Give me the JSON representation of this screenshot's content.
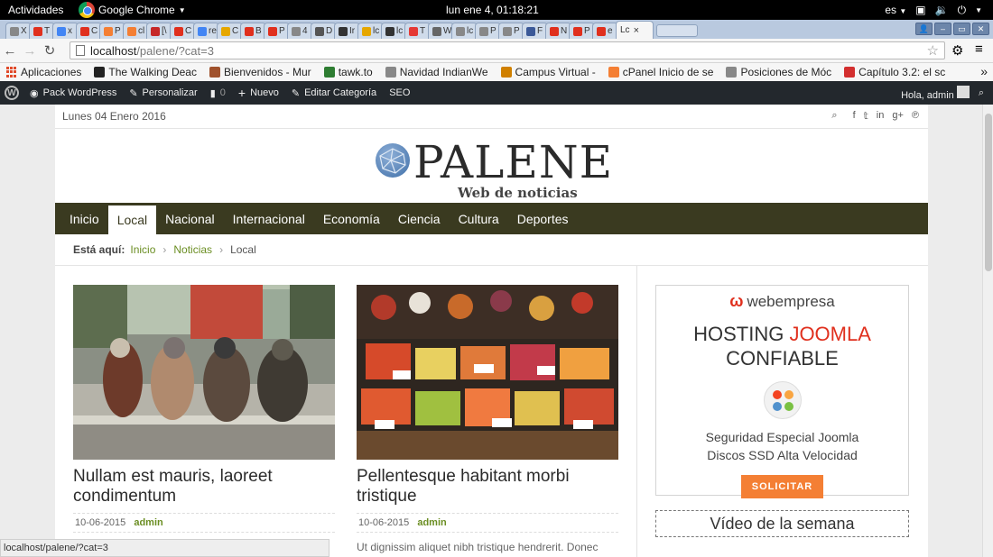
{
  "gnome": {
    "activities": "Actividades",
    "app_name": "Google Chrome",
    "clock": "lun ene  4, 01:18:21",
    "lang": "es"
  },
  "tabs": [
    {
      "letter": "X",
      "color": "#888"
    },
    {
      "letter": "T",
      "color": "#e0301e"
    },
    {
      "letter": "x",
      "color": "#4285f4"
    },
    {
      "letter": "C",
      "color": "#e0301e"
    },
    {
      "letter": "P",
      "color": "#f47f34"
    },
    {
      "letter": "cl",
      "color": "#f47f34"
    },
    {
      "letter": "[\\",
      "color": "#c62828"
    },
    {
      "letter": "C",
      "color": "#e0301e"
    },
    {
      "letter": "re",
      "color": "#4285f4"
    },
    {
      "letter": "C",
      "color": "#e6a700"
    },
    {
      "letter": "B",
      "color": "#e0301e"
    },
    {
      "letter": "P",
      "color": "#e0301e"
    },
    {
      "letter": "4",
      "color": "#888"
    },
    {
      "letter": "D",
      "color": "#555"
    },
    {
      "letter": "Ir",
      "color": "#333"
    },
    {
      "letter": "lc",
      "color": "#e6a700"
    },
    {
      "letter": "lc",
      "color": "#333"
    },
    {
      "letter": "T",
      "color": "#e53935"
    },
    {
      "letter": "W",
      "color": "#666"
    },
    {
      "letter": "lc",
      "color": "#888"
    },
    {
      "letter": "P",
      "color": "#888"
    },
    {
      "letter": "P",
      "color": "#888"
    },
    {
      "letter": "F",
      "color": "#3b5998"
    },
    {
      "letter": "N",
      "color": "#e0301e"
    },
    {
      "letter": "P",
      "color": "#e0301e"
    },
    {
      "letter": "e",
      "color": "#e0301e"
    }
  ],
  "active_tab": {
    "label": "Lc",
    "close": "×"
  },
  "toolbar": {
    "url_host": "localhost",
    "url_rest": "/palene/?cat=3"
  },
  "bookmarks": [
    {
      "label": "Aplicaciones",
      "color": "#e04a2a"
    },
    {
      "label": "The Walking Deac",
      "color": "#222"
    },
    {
      "label": "Bienvenidos - Mur",
      "color": "#a0522d"
    },
    {
      "label": "tawk.to",
      "color": "#2e7d32"
    },
    {
      "label": "Navidad IndianWe",
      "color": "#888"
    },
    {
      "label": "Campus Virtual -",
      "color": "#d08000"
    },
    {
      "label": "cPanel Inicio de se",
      "color": "#f47f34"
    },
    {
      "label": "Posiciones de Móc",
      "color": "#888"
    },
    {
      "label": "Capítulo 3.2: el sc",
      "color": "#d32f2f"
    }
  ],
  "wpbar": {
    "site": "Pack WordPress",
    "customize": "Personalizar",
    "comments": "0",
    "new": "Nuevo",
    "edit": "Editar Categoría",
    "seo": "SEO",
    "greeting": "Hola, admin"
  },
  "site": {
    "date": "Lunes 04 Enero 2016",
    "logo_title": "PALENE",
    "logo_subtitle": "Web de noticias",
    "nav": [
      "Inicio",
      "Local",
      "Nacional",
      "Internacional",
      "Economía",
      "Ciencia",
      "Cultura",
      "Deportes"
    ],
    "active_nav": "Local",
    "breadcrumb": {
      "label": "Está aquí:",
      "items": [
        "Inicio",
        "Noticias",
        "Local"
      ]
    },
    "posts": [
      {
        "title": "Nullam est mauris, laoreet condimentum",
        "date": "10-06-2015",
        "author": "admin",
        "excerpt": ""
      },
      {
        "title": "Pellentesque habitant morbi tristique",
        "date": "10-06-2015",
        "author": "admin",
        "excerpt": "Ut dignissim aliquet nibh tristique hendrerit. Donec"
      }
    ],
    "ad": {
      "brand": "webempresa",
      "headline_1a": "HOSTING ",
      "headline_1b": "JOOMLA",
      "headline_2": "CONFIABLE",
      "line1": "Seguridad Especial Joomla",
      "line2": "Discos SSD Alta Velocidad",
      "button": "SOLICITAR"
    },
    "video_title": "Vídeo de la semana"
  },
  "status_url": "localhost/palene/?cat=3"
}
